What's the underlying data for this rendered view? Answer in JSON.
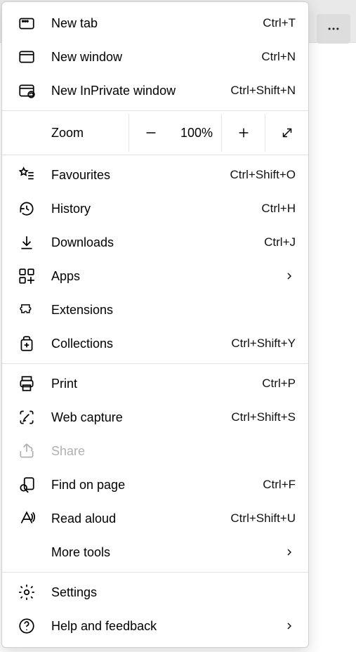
{
  "zoom": {
    "label": "Zoom",
    "value": "100%"
  },
  "sections": [
    [
      {
        "id": "new-tab",
        "label": "New tab",
        "shortcut": "Ctrl+T"
      },
      {
        "id": "new-window",
        "label": "New window",
        "shortcut": "Ctrl+N"
      },
      {
        "id": "new-inprivate",
        "label": "New InPrivate window",
        "shortcut": "Ctrl+Shift+N"
      }
    ],
    [
      {
        "id": "favourites",
        "label": "Favourites",
        "shortcut": "Ctrl+Shift+O"
      },
      {
        "id": "history",
        "label": "History",
        "shortcut": "Ctrl+H"
      },
      {
        "id": "downloads",
        "label": "Downloads",
        "shortcut": "Ctrl+J"
      },
      {
        "id": "apps",
        "label": "Apps",
        "submenu": true
      },
      {
        "id": "extensions",
        "label": "Extensions"
      },
      {
        "id": "collections",
        "label": "Collections",
        "shortcut": "Ctrl+Shift+Y"
      }
    ],
    [
      {
        "id": "print",
        "label": "Print",
        "shortcut": "Ctrl+P"
      },
      {
        "id": "web-capture",
        "label": "Web capture",
        "shortcut": "Ctrl+Shift+S"
      },
      {
        "id": "share",
        "label": "Share",
        "disabled": true
      },
      {
        "id": "find",
        "label": "Find on page",
        "shortcut": "Ctrl+F"
      },
      {
        "id": "read-aloud",
        "label": "Read aloud",
        "shortcut": "Ctrl+Shift+U"
      },
      {
        "id": "more-tools",
        "label": "More tools",
        "submenu": true,
        "noicon": true
      }
    ],
    [
      {
        "id": "settings",
        "label": "Settings"
      },
      {
        "id": "help",
        "label": "Help and feedback",
        "submenu": true
      }
    ]
  ],
  "icons": {
    "new-tab": "tab",
    "new-window": "window",
    "new-inprivate": "inprivate",
    "favourites": "star-list",
    "history": "history",
    "downloads": "download",
    "apps": "apps",
    "extensions": "puzzle",
    "collections": "collections",
    "print": "printer",
    "web-capture": "capture",
    "share": "share",
    "find": "find",
    "read-aloud": "read-aloud",
    "settings": "gear",
    "help": "help"
  }
}
